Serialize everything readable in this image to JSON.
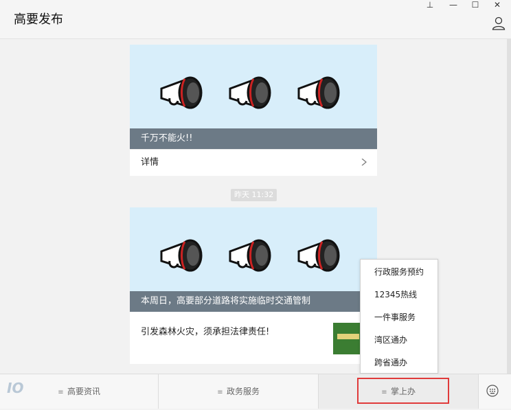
{
  "window": {
    "title": "高要发布",
    "pin": "⊥",
    "minimize": "—",
    "maximize": "☐",
    "close": "✕"
  },
  "messages": [
    {
      "caption": "千万不能火!!",
      "detail": "详情"
    },
    {
      "time": "昨天 11:32",
      "caption": "本周日，高要部分道路将实施临时交通管制",
      "summary": "引发森林火灾，须承担法律责任!"
    }
  ],
  "popup_menu": [
    "行政服务预约",
    "12345热线",
    "一件事服务",
    "湾区通办",
    "跨省通办"
  ],
  "tabs": [
    "高要资讯",
    "政务服务",
    "掌上办"
  ],
  "logo": "IO",
  "icons": {
    "person": "person-icon",
    "chevron": "chevron-right-icon",
    "keyboard": "keyboard-icon",
    "megaphone": "megaphone-icon",
    "menu": "menu-icon"
  },
  "colors": {
    "banner": "#d8eefa",
    "caption": "#6c7a86",
    "highlight": "#e03a3a",
    "horn_stripe": "#cc2222"
  }
}
